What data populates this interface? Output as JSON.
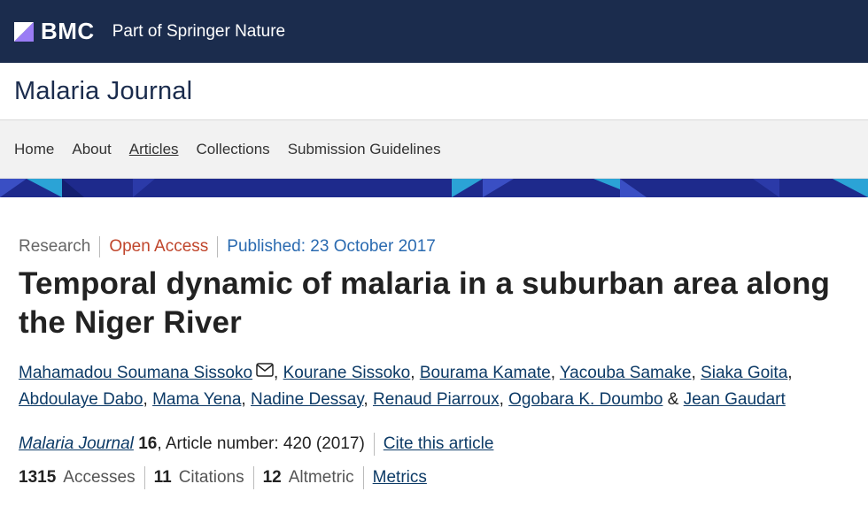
{
  "header": {
    "brand": "BMC",
    "tagline": "Part of Springer Nature"
  },
  "journal": {
    "title": "Malaria Journal"
  },
  "nav": {
    "items": [
      {
        "label": "Home"
      },
      {
        "label": "About"
      },
      {
        "label": "Articles"
      },
      {
        "label": "Collections"
      },
      {
        "label": "Submission Guidelines"
      }
    ]
  },
  "article": {
    "type": "Research",
    "access": "Open Access",
    "published": "Published: 23 October 2017",
    "title": "Temporal dynamic of malaria in a suburban area along the Niger River",
    "authors": [
      "Mahamadou Soumana Sissoko",
      "Kourane Sissoko",
      "Bourama Kamate",
      "Yacouba Samake",
      "Siaka Goita",
      "Abdoulaye Dabo",
      "Mama Yena",
      "Nadine Dessay",
      "Renaud Piarroux",
      "Ogobara K. Doumbo",
      "Jean Gaudart"
    ],
    "citation": {
      "journal": "Malaria Journal",
      "volume": "16",
      "rest": ", Article number: 420 (2017)",
      "cite_link": "Cite this article"
    },
    "metrics": {
      "accesses_count": "1315",
      "accesses_label": "Accesses",
      "citations_count": "11",
      "citations_label": "Citations",
      "altmetric_count": "12",
      "altmetric_label": "Altmetric",
      "metrics_link": "Metrics"
    }
  },
  "colors": {
    "topbar": "#1b2c4d",
    "open_access": "#c0452b",
    "published": "#2a6ab0",
    "banner": "#1e2a8c"
  },
  "icons": [
    "bmc-logo-icon",
    "email-icon"
  ]
}
